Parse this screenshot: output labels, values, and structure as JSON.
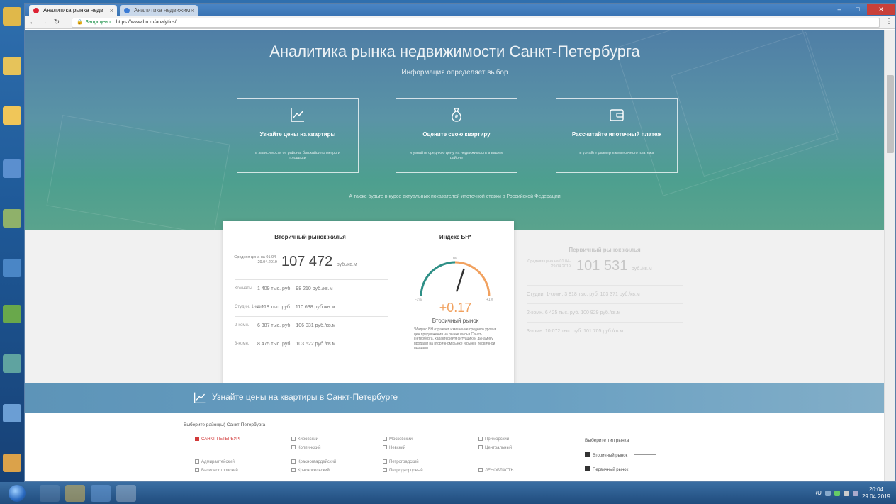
{
  "browser": {
    "tabs": [
      {
        "title": "Аналитика рынка недв"
      },
      {
        "title": "Аналитика недвижим"
      }
    ],
    "address": {
      "security_label": "Защищено",
      "url": "https://www.bn.ru/analytics/"
    }
  },
  "hero": {
    "title": "Аналитика рынка недвижимости Санкт-Петербурга",
    "subtitle": "Информация определяет выбор",
    "cards": [
      {
        "title": "Узнайте цены на квартиры",
        "desc": "в зависимости от района, ближайшего метро и площади"
      },
      {
        "title": "Оцените свою квартиру",
        "desc": "и узнайте среднюю цену на недвижимость в вашем районе"
      },
      {
        "title": "Рассчитайте ипотечный платеж",
        "desc": "и узнайте размер ежемесячного платежа"
      }
    ],
    "note": "А также будьте в курсе актуальных показателей ипотечной ставки в Российской Федерации"
  },
  "secondary": {
    "title": "Вторичный рынок жилья",
    "price_label": "Средняя цена на 01.04-29.04.2019",
    "price": "107 472",
    "unit": "руб./кв.м",
    "rows": [
      {
        "label": "Комнаты",
        "total": "1 409 тыс. руб.",
        "per_m": "98 210 руб./кв.м"
      },
      {
        "label": "Студии, 1-комн.",
        "total": "4 118 тыс. руб.",
        "per_m": "110 638 руб./кв.м"
      },
      {
        "label": "2-комн.",
        "total": "6 387 тыс. руб.",
        "per_m": "106 031 руб./кв.м"
      },
      {
        "label": "3-комн.",
        "total": "8 475 тыс. руб.",
        "per_m": "103 522 руб./кв.м"
      }
    ]
  },
  "index": {
    "title": "Индекс БН*",
    "value": "+0.17",
    "subtitle": "Вторичный рынок",
    "gauge_level": 0.6,
    "min_label": "-1%",
    "mid_label": "0%",
    "max_label": "+1%",
    "desc": "*Индекс БН отражает изменение среднего уровня цен предложения на рынке жилья Санкт-Петербурга, характеризуя ситуацию и динамику продажи на вторичном рынке и рынке первичной продажи"
  },
  "primary": {
    "title": "Первичный рынок жилья",
    "price_label": "Средняя цена на 01.04-29.04.2019",
    "price": "101 531",
    "unit": "руб./кв.м",
    "rows": [
      {
        "label": "Студии, 1-комн.",
        "total": "3 818 тыс. руб.",
        "per_m": "103 371 руб./кв.м"
      },
      {
        "label": "2-комн.",
        "total": "6 425 тыс. руб.",
        "per_m": "100 929 руб./кв.м"
      },
      {
        "label": "3-комн.",
        "total": "10 072 тыс. руб.",
        "per_m": "101 705 руб./кв.м"
      }
    ]
  },
  "banner": {
    "text": "Узнайте цены на квартиры в Санкт-Петербурге"
  },
  "filters": {
    "title": "Выберите район(ы) Санкт-Петербурга",
    "districts": {
      "selected": "САНКТ-ПЕТЕРБУРГ",
      "col2": [
        "Кировский",
        "Колпинский",
        "Красногвардейский",
        "Красносельский"
      ],
      "col3": [
        "Московский",
        "Невский",
        "Петроградский",
        "Петродворцовый"
      ],
      "col4": [
        "Приморский",
        "Центральный",
        "",
        "ЛЕНОБЛАСТЬ"
      ],
      "col1": [
        "Адмиралтейский",
        "Василеостровский"
      ]
    },
    "market_type": {
      "title": "Выберите тип рынка",
      "items": [
        "Вторичный рынок",
        "Первичный рынок"
      ]
    }
  },
  "taskbar": {
    "time": "20:04",
    "date": "29.04.2019",
    "lang": "RU"
  },
  "colors": {
    "accent_orange": "#f1a15f",
    "accent_teal": "#2e8f86",
    "selected_red": "#d23a3a"
  }
}
